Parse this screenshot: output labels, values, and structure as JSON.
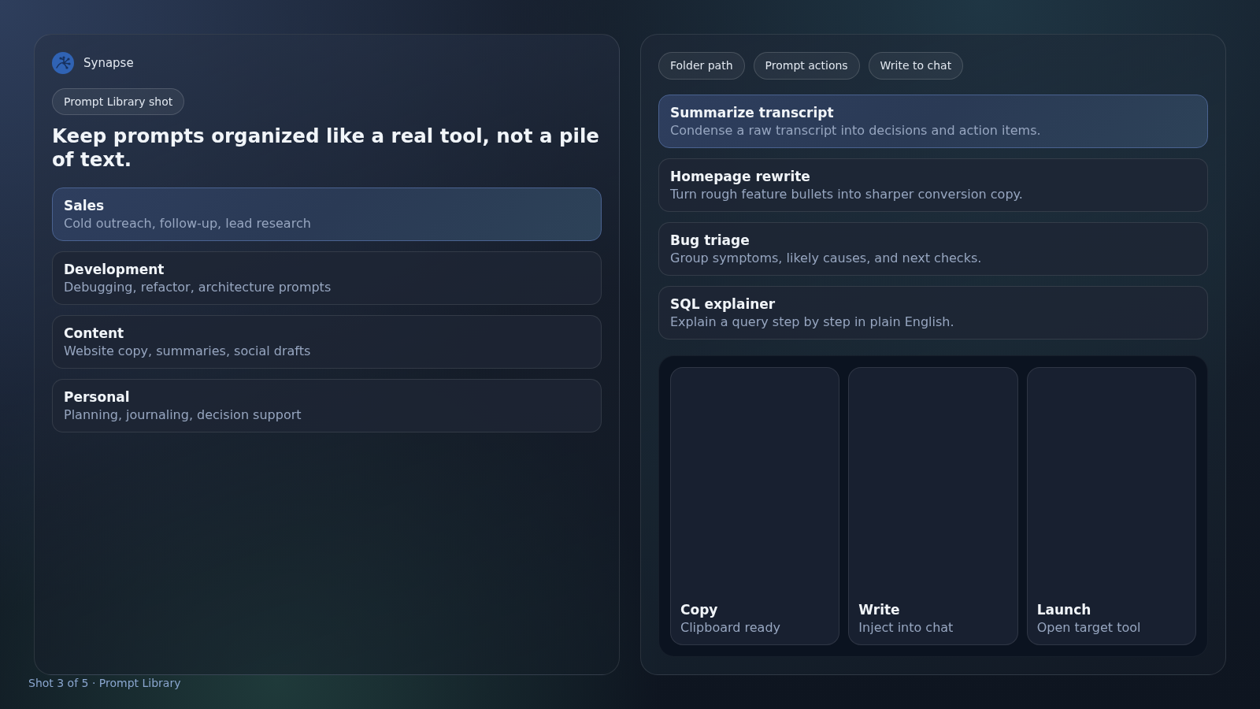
{
  "brand": {
    "name": "Synapse"
  },
  "left_panel": {
    "chip": "Prompt Library shot",
    "heading": "Keep prompts organized like a real tool, not a pile of text.",
    "folders": [
      {
        "name": "Sales",
        "description": "Cold outreach, follow-up, lead research",
        "selected": true
      },
      {
        "name": "Development",
        "description": "Debugging, refactor, architecture prompts",
        "selected": false
      },
      {
        "name": "Content",
        "description": "Website copy, summaries, social drafts",
        "selected": false
      },
      {
        "name": "Personal",
        "description": "Planning, journaling, decision support",
        "selected": false
      }
    ]
  },
  "right_panel": {
    "chips": [
      "Folder path",
      "Prompt actions",
      "Write to chat"
    ],
    "prompts": [
      {
        "title": "Summarize transcript",
        "description": "Condense a raw transcript into decisions and action items.",
        "selected": true
      },
      {
        "title": "Homepage rewrite",
        "description": "Turn rough feature bullets into sharper conversion copy.",
        "selected": false
      },
      {
        "title": "Bug triage",
        "description": "Group symptoms, likely causes, and next checks.",
        "selected": false
      },
      {
        "title": "SQL explainer",
        "description": "Explain a query step by step in plain English.",
        "selected": false
      }
    ],
    "actions": [
      {
        "title": "Copy",
        "subtitle": "Clipboard ready"
      },
      {
        "title": "Write",
        "subtitle": "Inject into chat"
      },
      {
        "title": "Launch",
        "subtitle": "Open target tool"
      }
    ]
  },
  "footer": "Shot 3 of 5 · Prompt Library"
}
